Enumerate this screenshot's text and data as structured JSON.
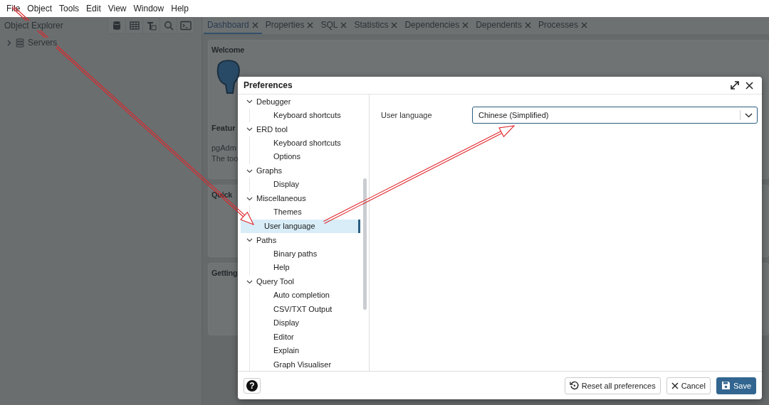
{
  "menu_bar": [
    "File",
    "Object",
    "Tools",
    "Edit",
    "View",
    "Window",
    "Help"
  ],
  "object_explorer": {
    "title": "Object Explorer",
    "tree": [
      {
        "label": "Servers",
        "expanded": false
      }
    ]
  },
  "tabs": [
    {
      "label": "Dashboard",
      "selected": true
    },
    {
      "label": "Properties",
      "selected": false
    },
    {
      "label": "SQL",
      "selected": false
    },
    {
      "label": "Statistics",
      "selected": false
    },
    {
      "label": "Dependencies",
      "selected": false
    },
    {
      "label": "Dependents",
      "selected": false
    },
    {
      "label": "Processes",
      "selected": false
    }
  ],
  "dashboard": {
    "panels": [
      {
        "title": "Welcome",
        "subheading": "Featur",
        "lines": [
          "pgAdm",
          "The too"
        ]
      },
      {
        "title": "Quick"
      },
      {
        "title": "Getting"
      }
    ]
  },
  "preferences": {
    "title": "Preferences",
    "tree": [
      {
        "label": "Debugger",
        "expanded": true,
        "children": [
          {
            "label": "Keyboard shortcuts",
            "selected": false
          }
        ]
      },
      {
        "label": "ERD tool",
        "expanded": true,
        "children": [
          {
            "label": "Keyboard shortcuts",
            "selected": false
          },
          {
            "label": "Options",
            "selected": false
          }
        ]
      },
      {
        "label": "Graphs",
        "expanded": true,
        "children": [
          {
            "label": "Display",
            "selected": false
          }
        ]
      },
      {
        "label": "Miscellaneous",
        "expanded": true,
        "children": [
          {
            "label": "Themes",
            "selected": false
          },
          {
            "label": "User language",
            "selected": true
          }
        ]
      },
      {
        "label": "Paths",
        "expanded": true,
        "children": [
          {
            "label": "Binary paths",
            "selected": false
          },
          {
            "label": "Help",
            "selected": false
          }
        ]
      },
      {
        "label": "Query Tool",
        "expanded": true,
        "children": [
          {
            "label": "Auto completion",
            "selected": false
          },
          {
            "label": "CSV/TXT Output",
            "selected": false
          },
          {
            "label": "Display",
            "selected": false
          },
          {
            "label": "Editor",
            "selected": false
          },
          {
            "label": "Explain",
            "selected": false
          },
          {
            "label": "Graph Visualiser",
            "selected": false
          }
        ]
      }
    ],
    "setting": {
      "label": "User language",
      "value": "Chinese (Simplified)"
    },
    "footer": {
      "help": "?",
      "reset": "Reset all preferences",
      "cancel": "Cancel",
      "save": "Save"
    }
  }
}
